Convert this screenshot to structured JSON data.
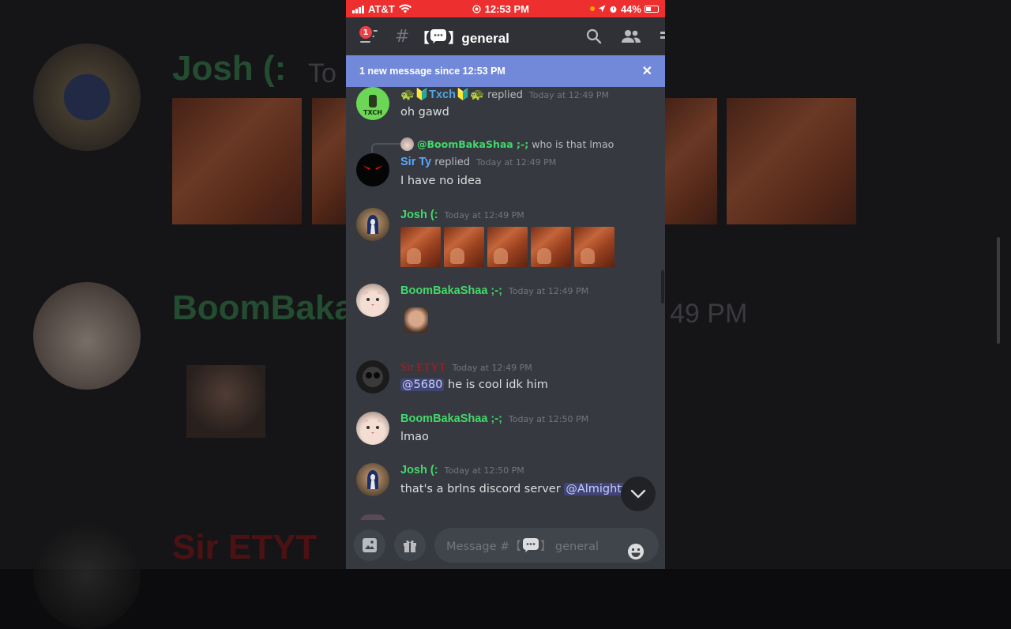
{
  "status_bar": {
    "carrier": "AT&T",
    "time": "12:53 PM",
    "battery": "44%"
  },
  "header": {
    "notification_count": "1",
    "hash": "#",
    "channel_prefix": "【",
    "channel_suffix": "】general"
  },
  "banner": {
    "text": "1 new message since 12:53 PM",
    "close": "✕"
  },
  "messages": [
    {
      "author": "🐢🔰Txch🔰🐢",
      "author_color": "#4fa6e8",
      "replied": "replied",
      "timestamp": "Today at 12:49 PM",
      "text": "oh gawd",
      "avatar_label": "TXCH"
    },
    {
      "reply_to": "@BoomBakaShaa ;-;",
      "reply_text": "who is that lmao",
      "author": "Sir Ty",
      "author_color": "#5ba8ff",
      "replied": "replied",
      "timestamp": "Today at 12:49 PM",
      "text": "I have no idea"
    },
    {
      "author": "Josh (:",
      "author_color": "#43d96b",
      "timestamp": "Today at 12:49 PM",
      "emoji_count": 5
    },
    {
      "author": "BoomBakaShaa ;-;",
      "author_color": "#43d96b",
      "timestamp": "Today at 12:49 PM"
    },
    {
      "author": "Sir ETYT",
      "author_color": "#b41c1c",
      "timestamp": "Today at 12:49 PM",
      "mention": "@5680",
      "text": "he is cool idk him"
    },
    {
      "author": "BoomBakaShaa ;-;",
      "author_color": "#43d96b",
      "timestamp": "Today at 12:50 PM",
      "text": "lmao"
    },
    {
      "author": "Josh (:",
      "author_color": "#43d96b",
      "timestamp": "Today at 12:50 PM",
      "text": "that's a brlns discord server",
      "mention": "@AlmightyH"
    }
  ],
  "composer": {
    "placeholder_prefix": "Message #【",
    "placeholder_suffix": "】 general"
  },
  "background": {
    "name1": "Josh (:",
    "name1_suffix": "To",
    "name2": "BoomBaka",
    "name3": "Sir ETYT",
    "time_fragment": "49 PM"
  }
}
